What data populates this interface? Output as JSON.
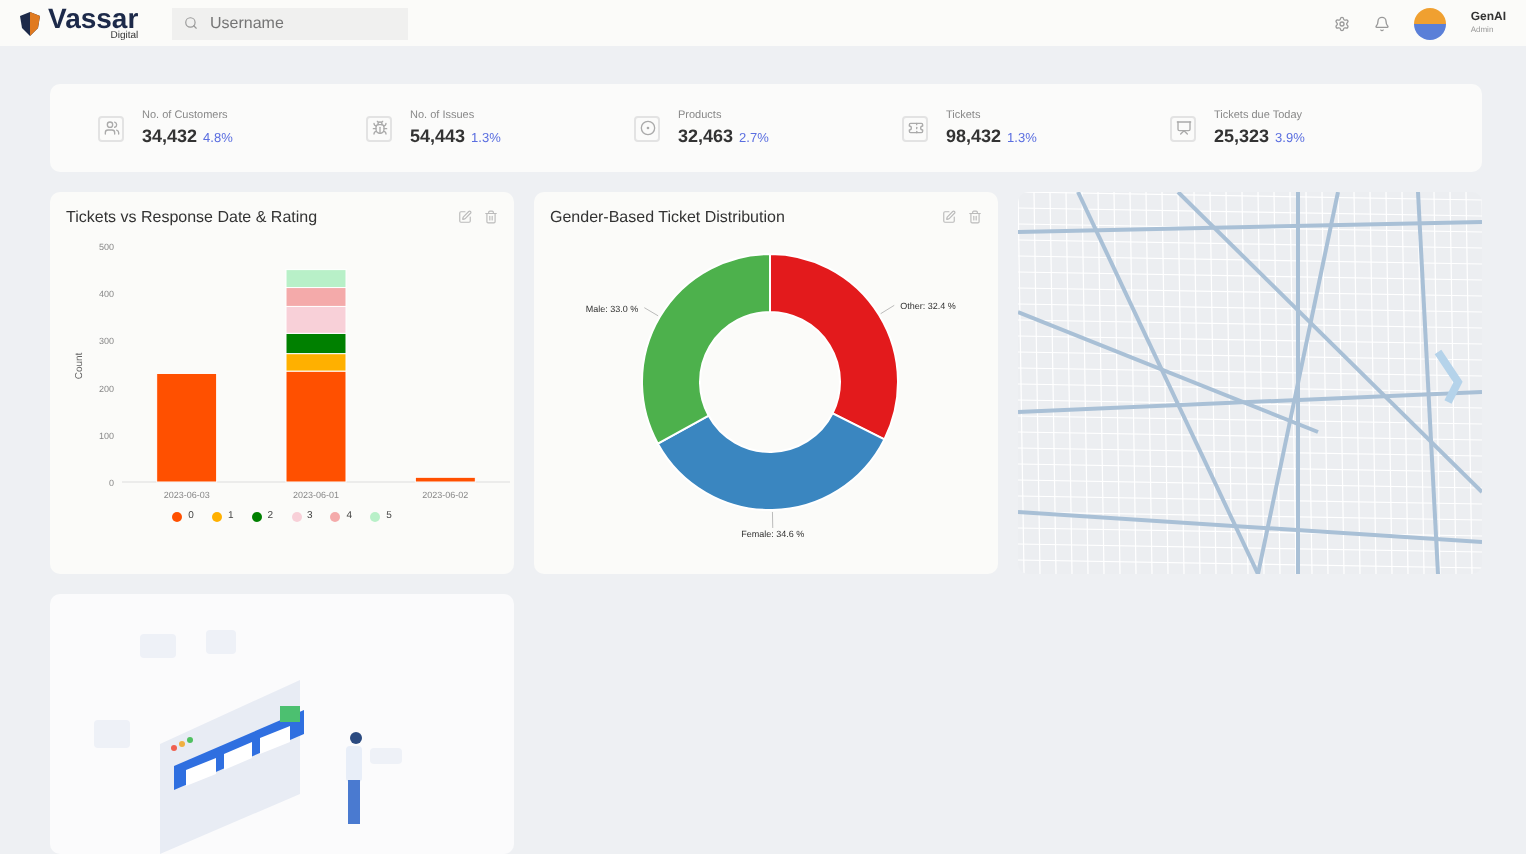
{
  "header": {
    "logo": {
      "name": "Vassar",
      "tagline": "Digital"
    },
    "search": {
      "placeholder": "Username"
    },
    "user": {
      "name": "GenAI",
      "role": "Admin"
    }
  },
  "stats": [
    {
      "kind": "customers",
      "label": "No. of Customers",
      "value": "34,432",
      "change": "4.8%"
    },
    {
      "kind": "issues",
      "label": "No. of Issues",
      "value": "54,443",
      "change": "1.3%"
    },
    {
      "kind": "products",
      "label": "Products",
      "value": "32,463",
      "change": "2.7%"
    },
    {
      "kind": "tickets",
      "label": "Tickets",
      "value": "98,432",
      "change": "1.3%"
    },
    {
      "kind": "due",
      "label": "Tickets due Today",
      "value": "25,323",
      "change": "3.9%"
    }
  ],
  "bar_card": {
    "title": "Tickets vs Response Date & Rating",
    "chart_data": {
      "type": "bar",
      "ylabel": "Count",
      "stacked": true,
      "categories": [
        "2023-06-03",
        "2023-06-01",
        "2023-06-02"
      ],
      "ylim": [
        0,
        500
      ],
      "yticks": [
        0,
        100,
        200,
        300,
        400,
        500
      ],
      "series": [
        {
          "name": "0",
          "color": "#ff5000",
          "values": [
            230,
            235,
            10
          ]
        },
        {
          "name": "1",
          "color": "#ffb000",
          "values": [
            0,
            37,
            0
          ]
        },
        {
          "name": "2",
          "color": "#008000",
          "values": [
            0,
            43,
            0
          ]
        },
        {
          "name": "3",
          "color": "#f8d0d8",
          "values": [
            0,
            57,
            0
          ]
        },
        {
          "name": "4",
          "color": "#f4aaaa",
          "values": [
            0,
            40,
            0
          ]
        },
        {
          "name": "5",
          "color": "#b8f0c8",
          "values": [
            0,
            38,
            0
          ]
        }
      ]
    }
  },
  "donut_card": {
    "title": "Gender-Based Ticket Distribution",
    "chart_data": {
      "type": "donut",
      "values": [
        32.4,
        34.6,
        33.0
      ],
      "colors": [
        "#e31a1c",
        "#3a86c0",
        "#4db14c"
      ],
      "value_labels": [
        "Other: 32.4 %",
        "Female: 34.6 %",
        "Male: 33.0 %"
      ]
    }
  }
}
